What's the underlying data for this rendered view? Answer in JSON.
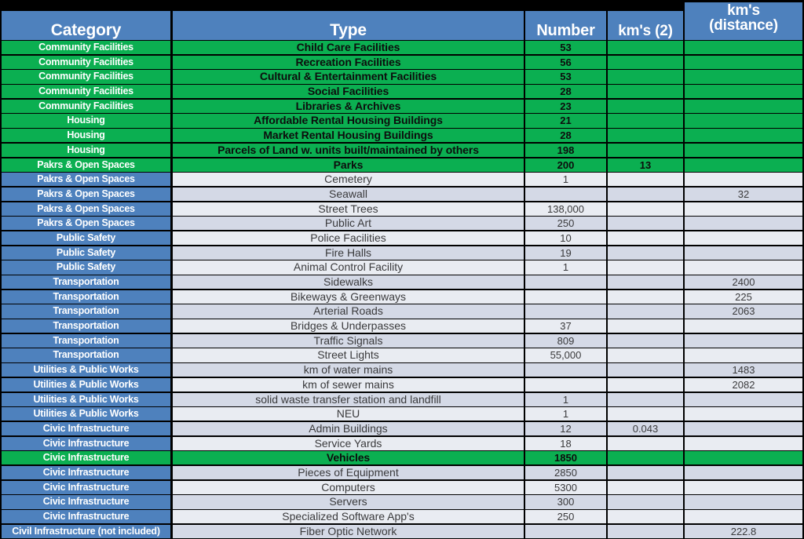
{
  "table": {
    "columns": [
      {
        "key": "category",
        "label": "Category"
      },
      {
        "key": "type",
        "label": "Type"
      },
      {
        "key": "number",
        "label": "Number"
      },
      {
        "key": "km2",
        "label": "km's (2)"
      },
      {
        "key": "kmdist",
        "label": "km's\n(distance)"
      }
    ],
    "header": {
      "category": "Category",
      "type": "Type",
      "number": "Number",
      "km2": "km's (2)",
      "kmdist_line1": "km's",
      "kmdist_line2": "(distance)"
    },
    "colors": {
      "header_blue": "#4E81BD",
      "category_blue": "#4E81BD",
      "highlight_green": "#0BAF51",
      "stripe_light": "#E9ECF2",
      "stripe_dark": "#D4D9E6",
      "page_background": "#000000",
      "body_text": "#3A3A3C"
    },
    "rows": [
      {
        "category": "Community Facilities",
        "type": "Child Care Facilities",
        "number": "53",
        "km2": "",
        "kmdist": "",
        "highlight": true
      },
      {
        "category": "Community Facilities",
        "type": "Recreation Facilities",
        "number": "56",
        "km2": "",
        "kmdist": "",
        "highlight": true
      },
      {
        "category": "Community Facilities",
        "type": "Cultural & Entertainment Facilities",
        "number": "53",
        "km2": "",
        "kmdist": "",
        "highlight": true
      },
      {
        "category": "Community Facilities",
        "type": "Social Facilities",
        "number": "28",
        "km2": "",
        "kmdist": "",
        "highlight": true
      },
      {
        "category": "Community Facilities",
        "type": "Libraries & Archives",
        "number": "23",
        "km2": "",
        "kmdist": "",
        "highlight": true
      },
      {
        "category": "Housing",
        "type": "Affordable Rental Housing Buildings",
        "number": "21",
        "km2": "",
        "kmdist": "",
        "highlight": true
      },
      {
        "category": "Housing",
        "type": "Market Rental Housing Buildings",
        "number": "28",
        "km2": "",
        "kmdist": "",
        "highlight": true
      },
      {
        "category": "Housing",
        "type": "Parcels of Land w. units built/maintained by others",
        "number": "198",
        "km2": "",
        "kmdist": "",
        "highlight": true
      },
      {
        "category": "Pakrs & Open Spaces",
        "type": "Parks",
        "number": "200",
        "km2": "13",
        "kmdist": "",
        "highlight": true
      },
      {
        "category": "Pakrs & Open Spaces",
        "type": "Cemetery",
        "number": "1",
        "km2": "",
        "kmdist": "",
        "highlight": false
      },
      {
        "category": "Pakrs & Open Spaces",
        "type": "Seawall",
        "number": "",
        "km2": "",
        "kmdist": "32",
        "highlight": false
      },
      {
        "category": "Pakrs & Open Spaces",
        "type": "Street Trees",
        "number": "138,000",
        "km2": "",
        "kmdist": "",
        "highlight": false
      },
      {
        "category": "Pakrs & Open Spaces",
        "type": "Public Art",
        "number": "250",
        "km2": "",
        "kmdist": "",
        "highlight": false
      },
      {
        "category": "Public Safety",
        "type": "Police Facilities",
        "number": "10",
        "km2": "",
        "kmdist": "",
        "highlight": false
      },
      {
        "category": "Public Safety",
        "type": "Fire Halls",
        "number": "19",
        "km2": "",
        "kmdist": "",
        "highlight": false
      },
      {
        "category": "Public Safety",
        "type": "Animal Control Facility",
        "number": "1",
        "km2": "",
        "kmdist": "",
        "highlight": false
      },
      {
        "category": "Transportation",
        "type": "Sidewalks",
        "number": "",
        "km2": "",
        "kmdist": "2400",
        "highlight": false
      },
      {
        "category": "Transportation",
        "type": "Bikeways & Greenways",
        "number": "",
        "km2": "",
        "kmdist": "225",
        "highlight": false
      },
      {
        "category": "Transportation",
        "type": "Arterial Roads",
        "number": "",
        "km2": "",
        "kmdist": "2063",
        "highlight": false
      },
      {
        "category": "Transportation",
        "type": "Bridges & Underpasses",
        "number": "37",
        "km2": "",
        "kmdist": "",
        "highlight": false
      },
      {
        "category": "Transportation",
        "type": "Traffic Signals",
        "number": "809",
        "km2": "",
        "kmdist": "",
        "highlight": false
      },
      {
        "category": "Transportation",
        "type": "Street Lights",
        "number": "55,000",
        "km2": "",
        "kmdist": "",
        "highlight": false
      },
      {
        "category": "Utilities & Public Works",
        "type": "km of water mains",
        "number": "",
        "km2": "",
        "kmdist": "1483",
        "highlight": false
      },
      {
        "category": "Utilities & Public Works",
        "type": "km of sewer mains",
        "number": "",
        "km2": "",
        "kmdist": "2082",
        "highlight": false
      },
      {
        "category": "Utilities & Public Works",
        "type": "solid waste transfer station and landfill",
        "number": "1",
        "km2": "",
        "kmdist": "",
        "highlight": false
      },
      {
        "category": "Utilities & Public Works",
        "type": "NEU",
        "number": "1",
        "km2": "",
        "kmdist": "",
        "highlight": false
      },
      {
        "category": "Civic Infrastructure",
        "type": "Admin Buildings",
        "number": "12",
        "km2": "0.043",
        "kmdist": "",
        "highlight": false
      },
      {
        "category": "Civic Infrastructure",
        "type": "Service Yards",
        "number": "18",
        "km2": "",
        "kmdist": "",
        "highlight": false
      },
      {
        "category": "Civic Infrastructure",
        "type": "Vehicles",
        "number": "1850",
        "km2": "",
        "kmdist": "",
        "highlight": true
      },
      {
        "category": "Civic Infrastructure",
        "type": "Pieces of Equipment",
        "number": "2850",
        "km2": "",
        "kmdist": "",
        "highlight": false
      },
      {
        "category": "Civic Infrastructure",
        "type": "Computers",
        "number": "5300",
        "km2": "",
        "kmdist": "",
        "highlight": false
      },
      {
        "category": "Civic Infrastructure",
        "type": "Servers",
        "number": "300",
        "km2": "",
        "kmdist": "",
        "highlight": false
      },
      {
        "category": "Civic Infrastructure",
        "type": "Specialized Software App's",
        "number": "250",
        "km2": "",
        "kmdist": "",
        "highlight": false
      },
      {
        "category": "Civil Infrastructure (not included)",
        "type": "Fiber Optic Network",
        "number": "",
        "km2": "",
        "kmdist": "222.8",
        "highlight": false
      }
    ]
  }
}
